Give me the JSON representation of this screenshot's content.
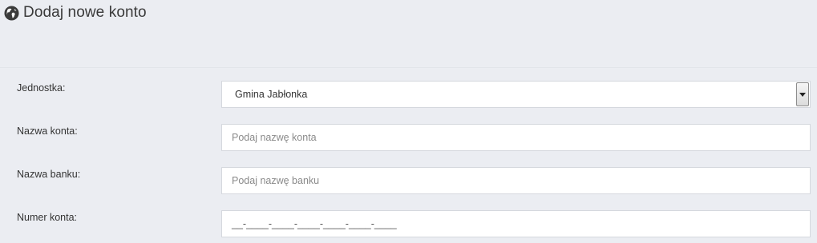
{
  "header": {
    "title": "Dodaj nowe konto",
    "icon": "globe-icon"
  },
  "form": {
    "jednostka": {
      "label": "Jednostka:",
      "selected": "Gmina Jabłonka"
    },
    "nazwa_konta": {
      "label": "Nazwa konta:",
      "value": "",
      "placeholder": "Podaj nazwę konta"
    },
    "nazwa_banku": {
      "label": "Nazwa banku:",
      "value": "",
      "placeholder": "Podaj nazwę banku"
    },
    "numer_konta": {
      "label": "Numer konta:",
      "mask": "__-____-____-____-____-____-____"
    }
  },
  "colors": {
    "background": "#ebedf2",
    "input_border": "#d5d8de",
    "text": "#333333",
    "placeholder": "#8a8a8a"
  }
}
